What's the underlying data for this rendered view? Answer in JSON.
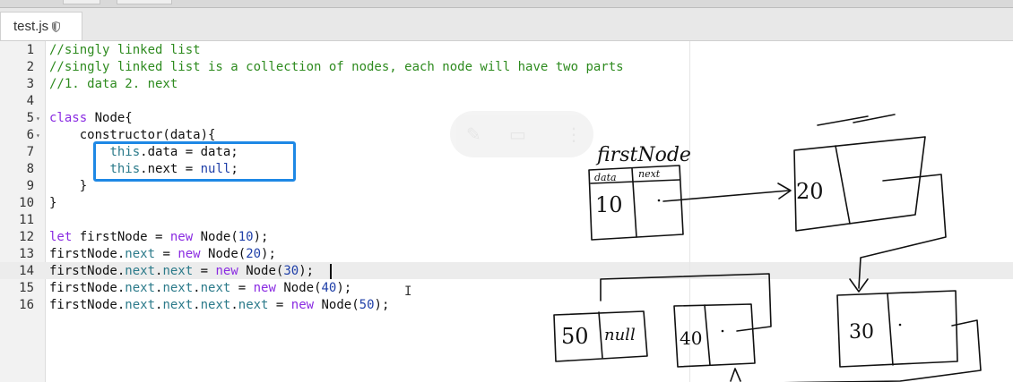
{
  "tab": {
    "filename": "test.js",
    "icon": "shield-icon"
  },
  "editor": {
    "lines": [
      {
        "num": "1",
        "fold": "",
        "segments": [
          {
            "t": "//singly linked list",
            "c": "c-comment"
          }
        ]
      },
      {
        "num": "2",
        "fold": "",
        "segments": [
          {
            "t": "//singly linked list is a collection of nodes, each node will have two parts",
            "c": "c-comment"
          }
        ]
      },
      {
        "num": "3",
        "fold": "",
        "segments": [
          {
            "t": "//1. data 2. next",
            "c": "c-comment"
          }
        ]
      },
      {
        "num": "4",
        "fold": "",
        "segments": []
      },
      {
        "num": "5",
        "fold": "▾",
        "segments": [
          {
            "t": "class",
            "c": "c-kw"
          },
          {
            "t": " Node{",
            "c": ""
          }
        ]
      },
      {
        "num": "6",
        "fold": "▾",
        "segments": [
          {
            "t": "    constructor(data){",
            "c": ""
          }
        ]
      },
      {
        "num": "7",
        "fold": "",
        "segments": [
          {
            "t": "        ",
            "c": ""
          },
          {
            "t": "this",
            "c": "c-this"
          },
          {
            "t": ".data = data;",
            "c": ""
          }
        ]
      },
      {
        "num": "8",
        "fold": "",
        "segments": [
          {
            "t": "        ",
            "c": ""
          },
          {
            "t": "this",
            "c": "c-this"
          },
          {
            "t": ".next = ",
            "c": ""
          },
          {
            "t": "null",
            "c": "c-num"
          },
          {
            "t": ";",
            "c": ""
          }
        ]
      },
      {
        "num": "9",
        "fold": "",
        "segments": [
          {
            "t": "    }",
            "c": ""
          }
        ]
      },
      {
        "num": "10",
        "fold": "",
        "segments": [
          {
            "t": "}",
            "c": ""
          }
        ]
      },
      {
        "num": "11",
        "fold": "",
        "segments": []
      },
      {
        "num": "12",
        "fold": "",
        "segments": [
          {
            "t": "let",
            "c": "c-kw"
          },
          {
            "t": " firstNode = ",
            "c": ""
          },
          {
            "t": "new",
            "c": "c-kw"
          },
          {
            "t": " Node(",
            "c": ""
          },
          {
            "t": "10",
            "c": "c-num"
          },
          {
            "t": ");",
            "c": ""
          }
        ]
      },
      {
        "num": "13",
        "fold": "",
        "segments": [
          {
            "t": "firstNode.",
            "c": ""
          },
          {
            "t": "next",
            "c": "c-prop"
          },
          {
            "t": " = ",
            "c": ""
          },
          {
            "t": "new",
            "c": "c-kw"
          },
          {
            "t": " Node(",
            "c": ""
          },
          {
            "t": "20",
            "c": "c-num"
          },
          {
            "t": ");",
            "c": ""
          }
        ]
      },
      {
        "num": "14",
        "fold": "",
        "segments": [
          {
            "t": "firstNode.",
            "c": ""
          },
          {
            "t": "next",
            "c": "c-prop"
          },
          {
            "t": ".",
            "c": ""
          },
          {
            "t": "next",
            "c": "c-prop"
          },
          {
            "t": " = ",
            "c": ""
          },
          {
            "t": "new",
            "c": "c-kw"
          },
          {
            "t": " Node(",
            "c": ""
          },
          {
            "t": "30",
            "c": "c-num"
          },
          {
            "t": ");",
            "c": ""
          }
        ]
      },
      {
        "num": "15",
        "fold": "",
        "segments": [
          {
            "t": "firstNode.",
            "c": ""
          },
          {
            "t": "next",
            "c": "c-prop"
          },
          {
            "t": ".",
            "c": ""
          },
          {
            "t": "next",
            "c": "c-prop"
          },
          {
            "t": ".",
            "c": ""
          },
          {
            "t": "next",
            "c": "c-prop"
          },
          {
            "t": " = ",
            "c": ""
          },
          {
            "t": "new",
            "c": "c-kw"
          },
          {
            "t": " Node(",
            "c": ""
          },
          {
            "t": "40",
            "c": "c-num"
          },
          {
            "t": ");",
            "c": ""
          }
        ]
      },
      {
        "num": "16",
        "fold": "",
        "segments": [
          {
            "t": "firstNode.",
            "c": ""
          },
          {
            "t": "next",
            "c": "c-prop"
          },
          {
            "t": ".",
            "c": ""
          },
          {
            "t": "next",
            "c": "c-prop"
          },
          {
            "t": ".",
            "c": ""
          },
          {
            "t": "next",
            "c": "c-prop"
          },
          {
            "t": ".",
            "c": ""
          },
          {
            "t": "next",
            "c": "c-prop"
          },
          {
            "t": " = ",
            "c": ""
          },
          {
            "t": "new",
            "c": "c-kw"
          },
          {
            "t": " Node(",
            "c": ""
          },
          {
            "t": "50",
            "c": "c-num"
          },
          {
            "t": ");",
            "c": ""
          }
        ]
      }
    ],
    "active_line": "14"
  },
  "drawing": {
    "label_first_node": "firstNode",
    "label_data": "data",
    "label_next": "next",
    "node_values": [
      "10",
      "20",
      "30",
      "40",
      "50"
    ],
    "null_label": "null"
  },
  "colors": {
    "highlight": "#1e88e5",
    "comment": "#2e8b1f",
    "keyword": "#8a2be2",
    "number": "#1f3fa8"
  }
}
